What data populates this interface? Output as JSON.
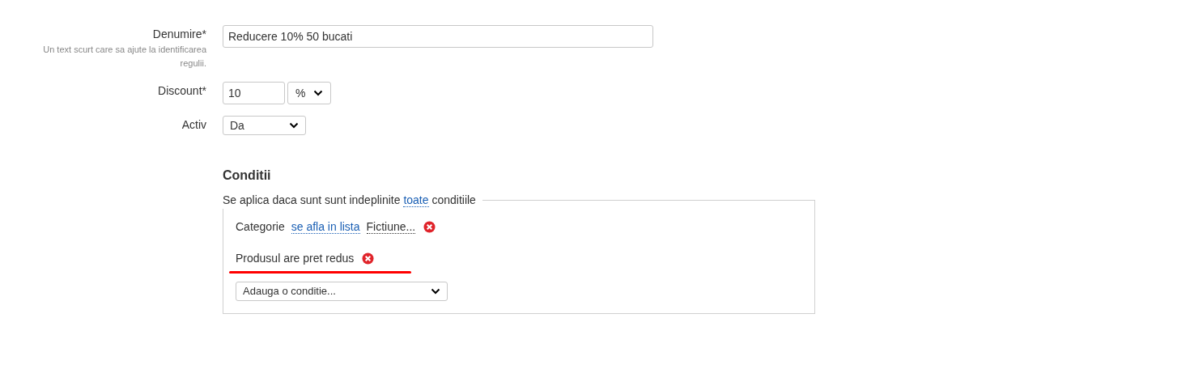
{
  "fields": [
    {
      "kind": "text",
      "label": "Denumire*",
      "hint": "Un text scurt care sa ajute la identificarea regulii.",
      "value": "Reducere 10% 50 bucati"
    },
    {
      "kind": "discount",
      "label": "Discount*",
      "value": "10",
      "unit": "%"
    },
    {
      "kind": "select",
      "label": "Activ",
      "value": "Da"
    }
  ],
  "conditions_section": {
    "title": "Conditii",
    "legend": {
      "before": "Se aplica daca sunt sunt indeplinite",
      "link": "toate",
      "after": "conditiile"
    },
    "conditions": [
      {
        "kind": "list",
        "field": "Categorie",
        "operator": "se afla in lista",
        "value": "Fictiune...",
        "highlighted": false
      },
      {
        "kind": "flag",
        "field": "Produsul are pret redus",
        "highlighted": true
      }
    ],
    "add_select": "Adauga o conditie..."
  }
}
